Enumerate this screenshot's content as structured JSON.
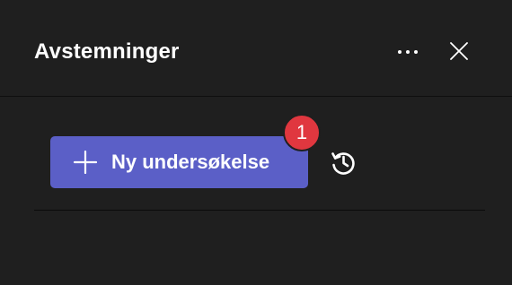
{
  "panel": {
    "title": "Avstemninger",
    "more_icon": "more-horizontal-icon",
    "close_icon": "close-icon"
  },
  "actions": {
    "new_poll_label": "Ny undersøkelse",
    "new_poll_icon": "plus-icon",
    "notification_count": "1",
    "history_icon": "history-icon"
  },
  "colors": {
    "background": "#1f1f1f",
    "accent": "#5b5fc7",
    "badge": "#e0373f"
  }
}
